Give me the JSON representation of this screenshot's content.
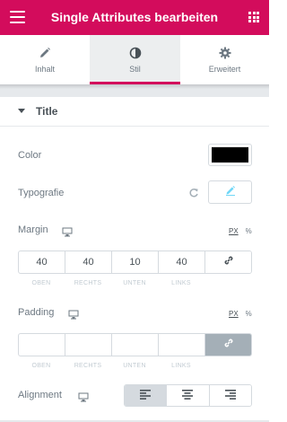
{
  "header": {
    "title": "Single Attributes bearbeiten",
    "menu_icon": "hamburger-menu-icon",
    "grid_icon": "apps-grid-icon",
    "background_color": "#d30c5c"
  },
  "tabs": [
    {
      "label": "Inhalt",
      "icon": "pencil-icon",
      "active": false
    },
    {
      "label": "Stil",
      "icon": "half-circle-icon",
      "active": true
    },
    {
      "label": "Erweitert",
      "icon": "gear-icon",
      "active": false
    }
  ],
  "section": {
    "title": "Title",
    "expanded": true
  },
  "controls": {
    "color": {
      "label": "Color",
      "value": "#000000"
    },
    "typography": {
      "label": "Typografie",
      "reset_icon": "reset-icon",
      "edit_icon": "pencil-icon"
    },
    "margin": {
      "label": "Margin",
      "device_icon": "desktop-icon",
      "unit_selected": "PX",
      "unit_alt": "%",
      "values": [
        "40",
        "40",
        "10",
        "40"
      ],
      "linked": false,
      "side_labels": [
        "OBEN",
        "RECHTS",
        "UNTEN",
        "LINKS"
      ]
    },
    "padding": {
      "label": "Padding",
      "device_icon": "desktop-icon",
      "unit_selected": "PX",
      "unit_alt": "%",
      "values": [
        "",
        "",
        "",
        ""
      ],
      "linked": true,
      "side_labels": [
        "OBEN",
        "RECHTS",
        "UNTEN",
        "LINKS"
      ]
    },
    "alignment": {
      "label": "Alignment",
      "device_icon": "desktop-icon",
      "options": [
        {
          "icon": "align-left-icon",
          "selected": true
        },
        {
          "icon": "align-center-icon",
          "selected": false
        },
        {
          "icon": "align-right-icon",
          "selected": false
        }
      ]
    }
  }
}
